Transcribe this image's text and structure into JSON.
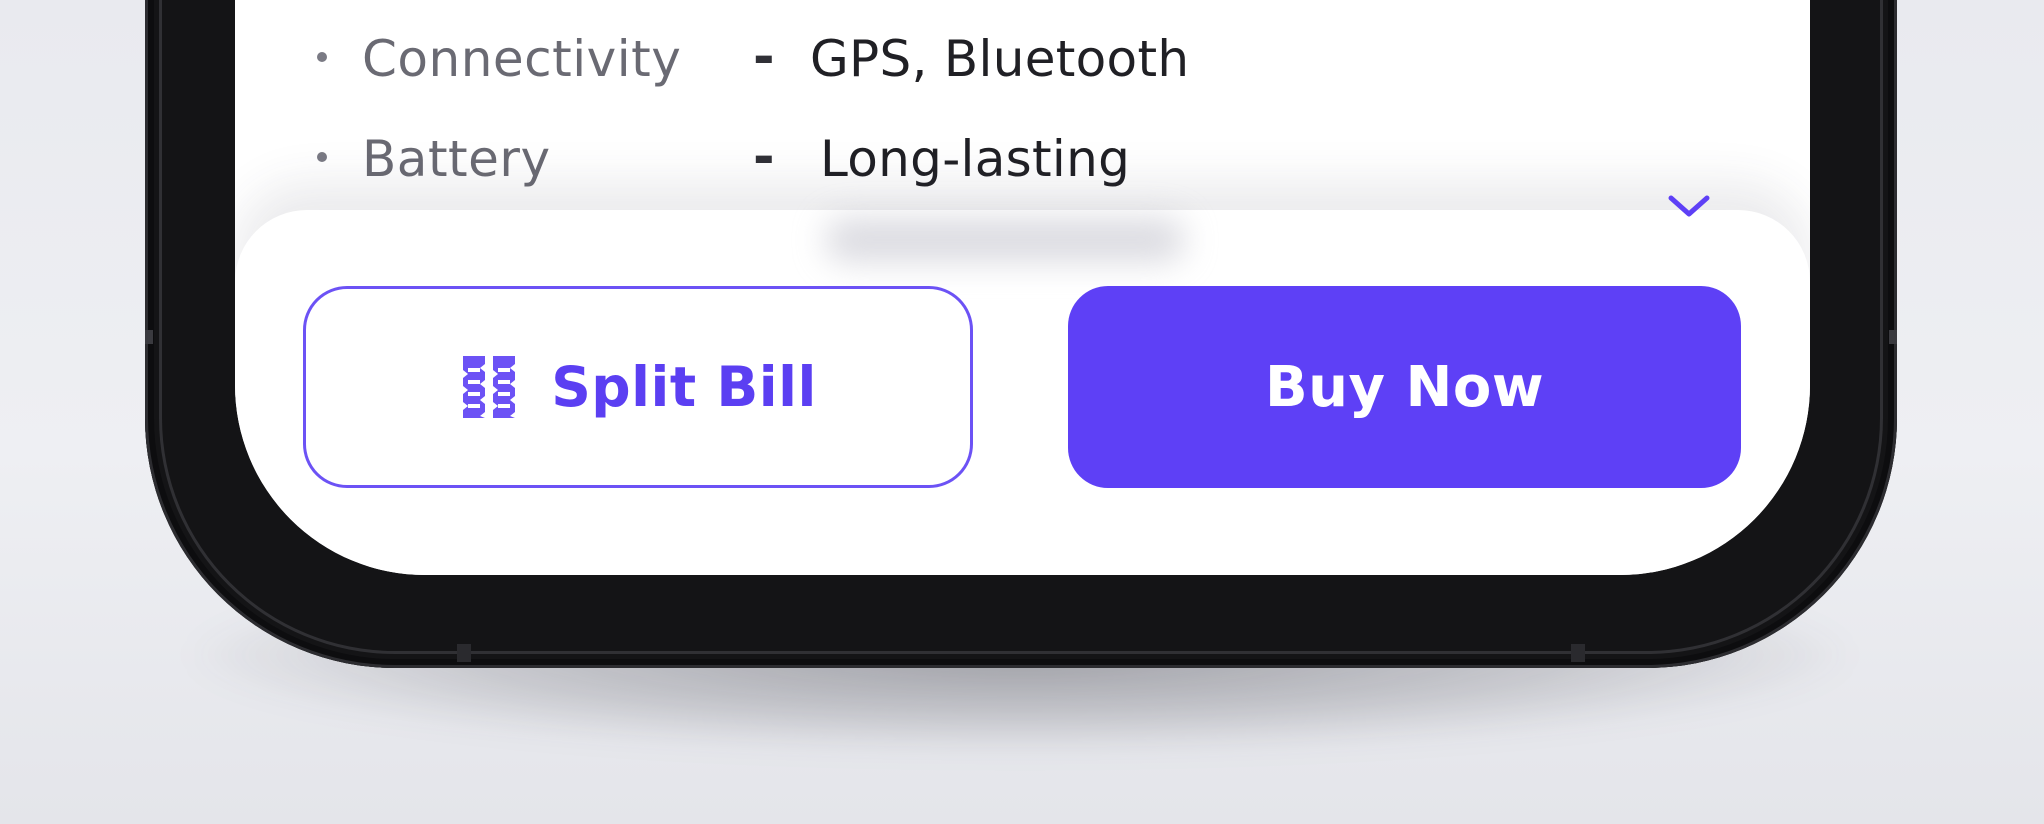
{
  "specs": [
    {
      "bullet": "•",
      "label": "Connectivity",
      "separator": "-",
      "value": "GPS, Bluetooth"
    },
    {
      "bullet": "•",
      "label": "Battery",
      "separator": "-",
      "value": "Long-lasting"
    }
  ],
  "actions": {
    "split_bill": {
      "label": "Split Bill",
      "icon": "receipt-split-icon"
    },
    "buy_now": {
      "label": "Buy Now"
    }
  },
  "sheet": {
    "toggle_icon": "chevron-down-icon"
  },
  "colors": {
    "accent": "#5e40f6",
    "accent_text": "#5b3ff2",
    "screen_bg": "#ffffff",
    "frame": "#141416",
    "backdrop": "#eceef2"
  }
}
